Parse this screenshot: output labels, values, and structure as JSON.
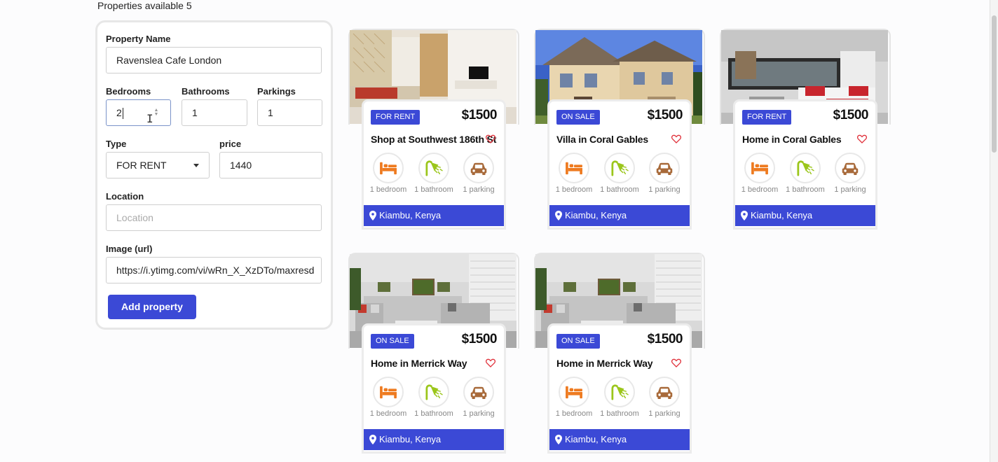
{
  "header": {
    "available_text": "Properties available 5"
  },
  "form": {
    "property_name_label": "Property Name",
    "property_name_value": "Ravenslea Cafe London",
    "bedrooms_label": "Bedrooms",
    "bedrooms_value": "2",
    "bathrooms_label": "Bathrooms",
    "bathrooms_value": "1",
    "parkings_label": "Parkings",
    "parkings_value": "1",
    "type_label": "Type",
    "type_value": "FOR RENT",
    "price_label": "price",
    "price_value": "1440",
    "location_label": "Location",
    "location_placeholder": "Location",
    "image_label": "Image (url)",
    "image_value": "https://i.ytimg.com/vi/wRn_X_XzDTo/maxresd",
    "add_button": "Add property"
  },
  "cards": [
    {
      "badge": "FOR RENT",
      "price": "$1500",
      "title": "Shop at Southwest 186th St",
      "bedroom": "1 bedroom",
      "bathroom": "1 bathroom",
      "parking": "1 parking",
      "location": "Kiambu, Kenya",
      "image": "living-room-stairs"
    },
    {
      "badge": "ON SALE",
      "price": "$1500",
      "title": "Villa in Coral Gables",
      "bedroom": "1 bedroom",
      "bathroom": "1 bathroom",
      "parking": "1 parking",
      "location": "Kiambu, Kenya",
      "image": "villa-exterior"
    },
    {
      "badge": "FOR RENT",
      "price": "$1500",
      "title": "Home in Coral Gables",
      "bedroom": "1 bedroom",
      "bathroom": "1 bathroom",
      "parking": "1 parking",
      "location": "Kiambu, Kenya",
      "image": "bedroom"
    },
    {
      "badge": "ON SALE",
      "price": "$1500",
      "title": "Home in Merrick Way",
      "bedroom": "1 bedroom",
      "bathroom": "1 bathroom",
      "parking": "1 parking",
      "location": "Kiambu, Kenya",
      "image": "grey-living-room"
    },
    {
      "badge": "ON SALE",
      "price": "$1500",
      "title": "Home in Merrick Way",
      "bedroom": "1 bedroom",
      "bathroom": "1 bathroom",
      "parking": "1 parking",
      "location": "Kiambu, Kenya",
      "image": "grey-living-room"
    }
  ],
  "colors": {
    "accent": "#3b49d6",
    "bed_icon": "#ee7a1f",
    "shower_icon": "#9bc61b",
    "car_icon": "#a86a3a",
    "heart": "#e0303a"
  },
  "icons": [
    "bed-icon",
    "shower-icon",
    "car-icon",
    "heart-icon",
    "map-pin-icon"
  ]
}
